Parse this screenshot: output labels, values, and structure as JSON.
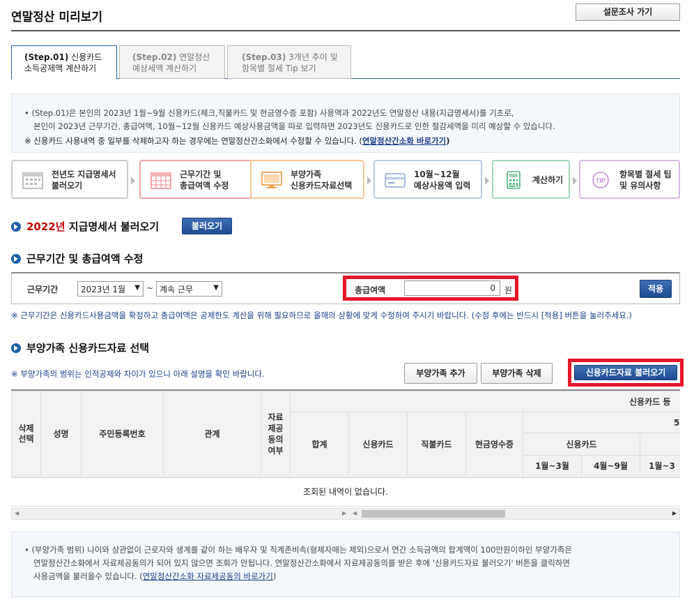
{
  "header": {
    "title": "연말정산 미리보기",
    "survey_button": "설문조사 가기"
  },
  "tabs": [
    {
      "step": "(Step.01)",
      "line1": "신용카드",
      "line2": "소득공제액 계산하기",
      "active": true
    },
    {
      "step": "(Step.02)",
      "line1": "연말정산",
      "line2": "예상세액 계산하기",
      "active": false
    },
    {
      "step": "(Step.03)",
      "line1": "3개년 추이 및",
      "line2": "항목별 절세 Tip 보기",
      "active": false
    }
  ],
  "info": {
    "line1": "• (Step.01)은 본인의 2023년 1월~9월 신용카드(체크,직불카드 및 현금영수증 포함) 사용액과 2022년도 연말정산 내용(지급명세서)를 기초로,",
    "line2": "본인이 2023년 근무기간, 총급여액, 10월~12월 신용카드 예상사용금액을 따로 입력하면 2023년도 신용카드로 인한 절감세액을 미리 예상할 수 있습니다.",
    "note": "※ 신용카드 사용내역 중 일부를 삭제하고자 하는 경우에는 연말정산간소화에서 수정할 수 있습니다. (",
    "link": "연말정산간소화 바로가기",
    "note_end": ")"
  },
  "steps": [
    {
      "line1": "전년도 지급명세서",
      "line2": "불러오기",
      "icon": "calendar-icon",
      "color": "#c8c8c8"
    },
    {
      "line1": "근무기간 및",
      "line2": "총급여액 수정",
      "icon": "calendar-grid-icon",
      "color": "#f2a3a3"
    },
    {
      "line1": "부양가족",
      "line2": "신용카드자료선택",
      "icon": "monitor-icon",
      "color": "#f7c792"
    },
    {
      "line1": "10월~12월",
      "line2": "예상사용액 입력",
      "icon": "card-icon",
      "color": "#b8c9e8"
    },
    {
      "line1": "계산하기",
      "line2": "",
      "icon": "calculator-icon",
      "color": "#9fd8b8"
    },
    {
      "line1": "항목별 절세 팁",
      "line2": "및 유의사항",
      "icon": "tip-icon",
      "color": "#d8b8e8"
    }
  ],
  "section1": {
    "year": "2022년",
    "title": " 지급명세서 불러오기",
    "button": "불러오기"
  },
  "section2": {
    "title": "근무기간 및 총급여액 수정",
    "period_label": "근무기간",
    "start_value": "2023년 1월",
    "tilde": "~",
    "status_value": "계속 근무",
    "salary_label": "총급여액",
    "salary_value": "0",
    "unit": "원",
    "apply_button": "적용",
    "note": "※ 근무기간은 신용카드사용금액을 확정하고 총급여액은 공제한도 계산을 위해 필요하므로 올해의 상황에 맞게 수정하여 주시기 바랍니다. (수정 후에는 반드시 [적용] 버튼을 눌러주세요.)"
  },
  "section3": {
    "title": "부양가족 신용카드자료 선택",
    "note": "※ 부양가족의 범위는 인적공제와 차이가 있으니 아래 설명을 확인 바랍니다.",
    "add_button": "부양가족 추가",
    "delete_button": "부양가족 삭제",
    "load_button": "신용카드자료 불러오기"
  },
  "table": {
    "headers": {
      "delete": "삭제선택",
      "name": "성명",
      "rrn": "주민등록번호",
      "relation": "관계",
      "consent": "자료제공동의여부",
      "card_group": "신용카드 등",
      "sub_group": "5",
      "total": "합계",
      "credit": "신용카드",
      "debit": "직불카드",
      "cash": "현금영수증",
      "credit2": "신용카드",
      "m1": "1월~3월",
      "m2": "4월~9월",
      "m3": "1월~3"
    },
    "empty_message": "조회된 내역이 없습니다."
  },
  "bottom": {
    "line1": "• (부양가족 범위) 나이와 상관없이 근로자와 생계를 같이 하는 배우자 및 직계존비속(형제자매는 제외)으로서 연간 소득금액의 합계액이 100만원이하인 부양가족은",
    "line2": "연말정산간소화에서 자료제공동의가 되어 있지 않으면 조회가 안됩니다. 연말정산간소화에서 자료제공동의를 받은 후에 '신용카드자료 불러오기' 버튼을 클릭하면",
    "line3": "사용금액을 불러올수 있습니다. (",
    "link": "연말정산간소화 자료제공동의 바로가기",
    "end": ")"
  }
}
